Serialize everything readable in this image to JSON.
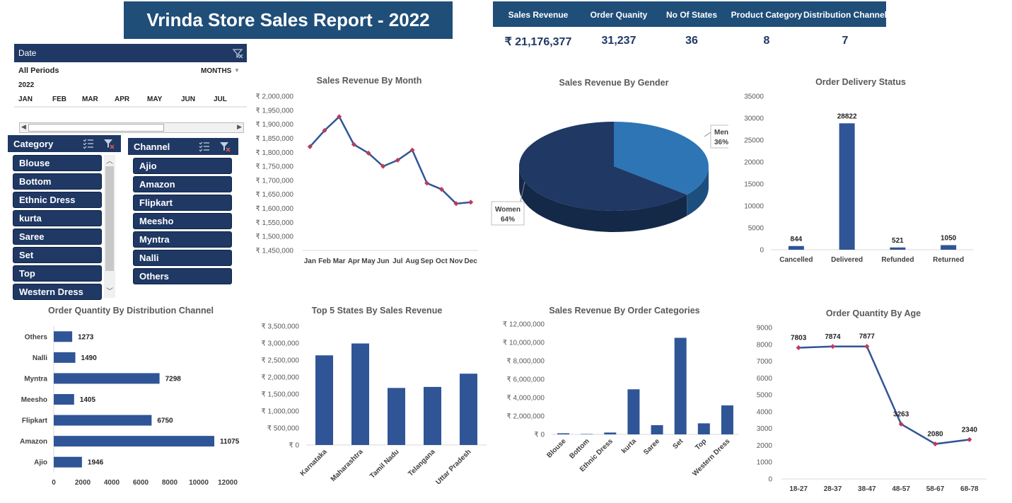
{
  "header": {
    "title": "Vrinda Store Sales  Report - 2022"
  },
  "kpis": [
    {
      "label": "Sales Revenue",
      "value": "₹ 21,176,377"
    },
    {
      "label": "Order Quanity",
      "value": "31,237"
    },
    {
      "label": "No Of States",
      "value": "36"
    },
    {
      "label": "Product Category",
      "value": "8"
    },
    {
      "label": "Distribution Channel",
      "value": "7"
    }
  ],
  "timeline": {
    "title": "Date",
    "period_label": "All Periods",
    "level": "MONTHS",
    "year": "2022",
    "months": [
      "JAN",
      "FEB",
      "MAR",
      "APR",
      "MAY",
      "JUN",
      "JUL"
    ]
  },
  "category_slicer": {
    "title": "Category",
    "items": [
      "Blouse",
      "Bottom",
      "Ethnic Dress",
      "kurta",
      "Saree",
      "Set",
      "Top",
      "Western Dress"
    ]
  },
  "channel_slicer": {
    "title": "Channel",
    "items": [
      "Ajio",
      "Amazon",
      "Flipkart",
      "Meesho",
      "Myntra",
      "Nalli",
      "Others"
    ]
  },
  "colors": {
    "navy": "#1f3864",
    "bar": "#2f5597",
    "pie_light": "#2e75b6",
    "marker": "#c0395a"
  },
  "chart_data": [
    {
      "id": "month",
      "type": "line",
      "title": "Sales Revenue By Month",
      "categories": [
        "Jan",
        "Feb",
        "Mar",
        "Apr",
        "May",
        "Jun",
        "Jul",
        "Aug",
        "Sep",
        "Oct",
        "Nov",
        "Dec"
      ],
      "values": [
        1820000,
        1878000,
        1927000,
        1828000,
        1797000,
        1750000,
        1772000,
        1808000,
        1690000,
        1668000,
        1617000,
        1622000
      ],
      "yticks": [
        "₹ 1,450,000",
        "₹ 1,500,000",
        "₹ 1,550,000",
        "₹ 1,600,000",
        "₹ 1,650,000",
        "₹ 1,700,000",
        "₹ 1,750,000",
        "₹ 1,800,000",
        "₹ 1,850,000",
        "₹ 1,900,000",
        "₹ 1,950,000",
        "₹ 2,000,000"
      ],
      "ylim": [
        1450000,
        2000000
      ]
    },
    {
      "id": "gender",
      "type": "pie",
      "title": "Sales Revenue By Gender",
      "slices": [
        {
          "label": "Men",
          "pct": "36%",
          "value": 36
        },
        {
          "label": "Women",
          "pct": "64%",
          "value": 64
        }
      ]
    },
    {
      "id": "delivery",
      "type": "bar",
      "title": "Order Delivery Status",
      "categories": [
        "Cancelled",
        "Delivered",
        "Refunded",
        "Returned"
      ],
      "values": [
        844,
        28822,
        521,
        1050
      ],
      "yticks": [
        "0",
        "5000",
        "10000",
        "15000",
        "20000",
        "25000",
        "30000",
        "35000"
      ],
      "ylim": [
        0,
        35000
      ]
    },
    {
      "id": "channel",
      "type": "bar",
      "orientation": "horizontal",
      "title": "Order Quantity By Distribution Channel",
      "categories": [
        "Others",
        "Nalli",
        "Myntra",
        "Meesho",
        "Flipkart",
        "Amazon",
        "Ajio"
      ],
      "values": [
        1273,
        1490,
        7298,
        1405,
        6750,
        11075,
        1946
      ],
      "xticks": [
        "0",
        "2000",
        "4000",
        "6000",
        "8000",
        "10000",
        "12000"
      ],
      "xlim": [
        0,
        12000
      ]
    },
    {
      "id": "states",
      "type": "bar",
      "title": "Top 5 States By Sales Revenue",
      "categories": [
        "Karnataka",
        "Maharashtra",
        "Tamil Nadu",
        "Telangana",
        "Uttar Pradesh"
      ],
      "values": [
        2640000,
        2990000,
        1680000,
        1710000,
        2100000
      ],
      "yticks": [
        "₹ 0",
        "₹ 500,000",
        "₹ 1,000,000",
        "₹ 1,500,000",
        "₹ 2,000,000",
        "₹ 2,500,000",
        "₹ 3,000,000",
        "₹ 3,500,000"
      ],
      "ylim": [
        0,
        3500000
      ]
    },
    {
      "id": "categories",
      "type": "bar",
      "title": "Sales Revenue By Order Categories",
      "categories": [
        "Blouse",
        "Bottom",
        "Ethnic Dress",
        "kurta",
        "Saree",
        "Set",
        "Top",
        "Western Dress"
      ],
      "values": [
        120000,
        40000,
        200000,
        4900000,
        1000000,
        10500000,
        1200000,
        3150000
      ],
      "yticks": [
        "₹ 0",
        "₹ 2,000,000",
        "₹ 4,000,000",
        "₹ 6,000,000",
        "₹ 8,000,000",
        "₹ 10,000,000",
        "₹ 12,000,000"
      ],
      "ylim": [
        0,
        12000000
      ]
    },
    {
      "id": "age",
      "type": "line",
      "title": "Order Quantity By Age",
      "categories": [
        "18-27",
        "28-37",
        "38-47",
        "48-57",
        "58-67",
        "68-78"
      ],
      "values": [
        7803,
        7874,
        7877,
        3263,
        2080,
        2340
      ],
      "yticks": [
        "0",
        "1000",
        "2000",
        "3000",
        "4000",
        "5000",
        "6000",
        "7000",
        "8000",
        "9000"
      ],
      "ylim": [
        0,
        9000
      ]
    }
  ]
}
